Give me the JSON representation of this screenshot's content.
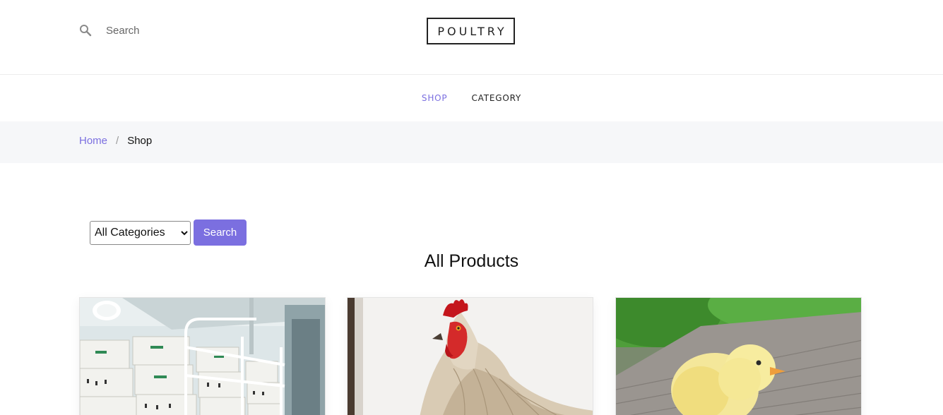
{
  "header": {
    "search_placeholder": "Search",
    "search_icon": "search-icon",
    "logo_text": "POULTRY"
  },
  "nav": {
    "items": [
      {
        "label": "SHOP",
        "active": true
      },
      {
        "label": "CATEGORY",
        "active": false
      }
    ]
  },
  "breadcrumb": {
    "home": "Home",
    "separator": "/",
    "current": "Shop"
  },
  "filter": {
    "selected_category": "All Categories",
    "button_label": "Search"
  },
  "main": {
    "title": "All Products"
  },
  "products": [
    {
      "image": "egg-hatchery-racks"
    },
    {
      "image": "hen-portrait"
    },
    {
      "image": "yellow-chick"
    }
  ],
  "colors": {
    "accent": "#7b6fe0",
    "breadcrumb_bg": "#f6f7f9",
    "text": "#222222"
  }
}
